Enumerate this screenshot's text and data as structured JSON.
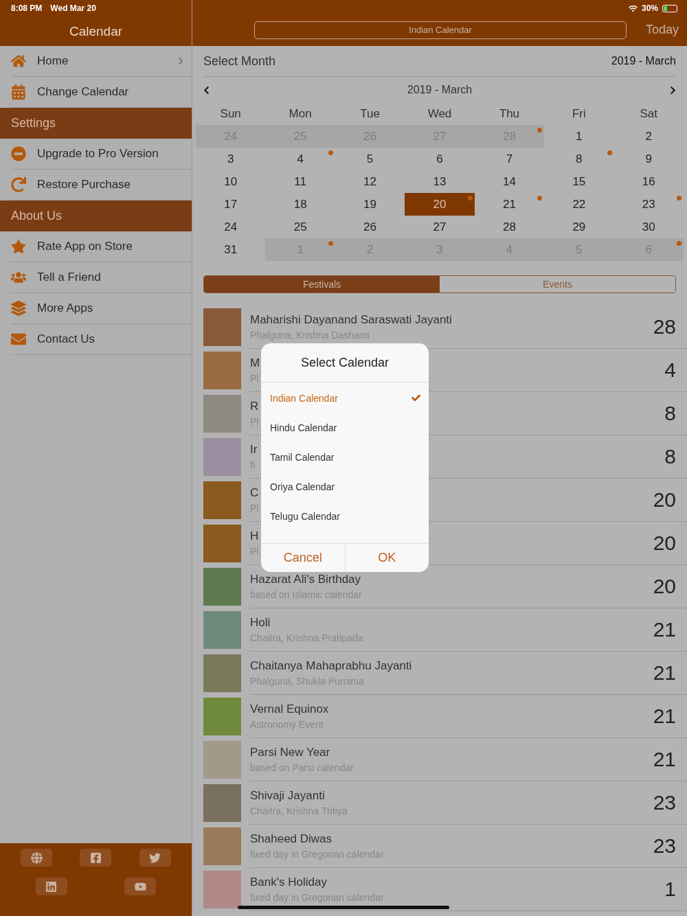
{
  "status_bar": {
    "time": "8:08 PM",
    "date": "Wed Mar 20",
    "battery": "30%"
  },
  "sidebar": {
    "title": "Calendar",
    "groups": [
      {
        "items": [
          {
            "label": "Home",
            "disclosure": true
          },
          {
            "label": "Change Calendar",
            "disclosure": false
          }
        ]
      },
      {
        "heading": "Settings",
        "items": [
          {
            "label": "Upgrade to Pro Version",
            "disclosure": false
          },
          {
            "label": "Restore Purchase",
            "disclosure": false
          }
        ]
      },
      {
        "heading": "About Us",
        "items": [
          {
            "label": "Rate App on Store",
            "disclosure": false
          },
          {
            "label": "Tell a Friend",
            "disclosure": false
          },
          {
            "label": "More Apps",
            "disclosure": false
          },
          {
            "label": "Contact Us",
            "disclosure": false
          }
        ]
      }
    ]
  },
  "nav_bar": {
    "calendar_button": "Indian Calendar",
    "today_button": "Today"
  },
  "month_selector": {
    "label": "Select Month",
    "value": "2019 - March"
  },
  "calendar": {
    "title": "2019 - March",
    "weekdays": [
      "Sun",
      "Mon",
      "Tue",
      "Wed",
      "Thu",
      "Fri",
      "Sat"
    ],
    "weeks": [
      [
        {
          "day": "24",
          "in_month": false,
          "event": false,
          "selected": false
        },
        {
          "day": "25",
          "in_month": false,
          "event": false,
          "selected": false
        },
        {
          "day": "26",
          "in_month": false,
          "event": false,
          "selected": false
        },
        {
          "day": "27",
          "in_month": false,
          "event": false,
          "selected": false
        },
        {
          "day": "28",
          "in_month": false,
          "event": true,
          "selected": false
        },
        {
          "day": "1",
          "in_month": true,
          "event": false,
          "selected": false
        },
        {
          "day": "2",
          "in_month": true,
          "event": false,
          "selected": false
        }
      ],
      [
        {
          "day": "3",
          "in_month": true,
          "event": false,
          "selected": false
        },
        {
          "day": "4",
          "in_month": true,
          "event": true,
          "selected": false
        },
        {
          "day": "5",
          "in_month": true,
          "event": false,
          "selected": false
        },
        {
          "day": "6",
          "in_month": true,
          "event": false,
          "selected": false
        },
        {
          "day": "7",
          "in_month": true,
          "event": false,
          "selected": false
        },
        {
          "day": "8",
          "in_month": true,
          "event": true,
          "selected": false
        },
        {
          "day": "9",
          "in_month": true,
          "event": false,
          "selected": false
        }
      ],
      [
        {
          "day": "10",
          "in_month": true,
          "event": false,
          "selected": false
        },
        {
          "day": "11",
          "in_month": true,
          "event": false,
          "selected": false
        },
        {
          "day": "12",
          "in_month": true,
          "event": false,
          "selected": false
        },
        {
          "day": "13",
          "in_month": true,
          "event": false,
          "selected": false
        },
        {
          "day": "14",
          "in_month": true,
          "event": false,
          "selected": false
        },
        {
          "day": "15",
          "in_month": true,
          "event": false,
          "selected": false
        },
        {
          "day": "16",
          "in_month": true,
          "event": false,
          "selected": false
        }
      ],
      [
        {
          "day": "17",
          "in_month": true,
          "event": false,
          "selected": false
        },
        {
          "day": "18",
          "in_month": true,
          "event": false,
          "selected": false
        },
        {
          "day": "19",
          "in_month": true,
          "event": false,
          "selected": false
        },
        {
          "day": "20",
          "in_month": true,
          "event": true,
          "selected": true
        },
        {
          "day": "21",
          "in_month": true,
          "event": true,
          "selected": false
        },
        {
          "day": "22",
          "in_month": true,
          "event": false,
          "selected": false
        },
        {
          "day": "23",
          "in_month": true,
          "event": true,
          "selected": false
        }
      ],
      [
        {
          "day": "24",
          "in_month": true,
          "event": false,
          "selected": false
        },
        {
          "day": "25",
          "in_month": true,
          "event": false,
          "selected": false
        },
        {
          "day": "26",
          "in_month": true,
          "event": false,
          "selected": false
        },
        {
          "day": "27",
          "in_month": true,
          "event": false,
          "selected": false
        },
        {
          "day": "28",
          "in_month": true,
          "event": false,
          "selected": false
        },
        {
          "day": "29",
          "in_month": true,
          "event": false,
          "selected": false
        },
        {
          "day": "30",
          "in_month": true,
          "event": false,
          "selected": false
        }
      ],
      [
        {
          "day": "31",
          "in_month": true,
          "event": false,
          "selected": false
        },
        {
          "day": "1",
          "in_month": false,
          "event": true,
          "selected": false
        },
        {
          "day": "2",
          "in_month": false,
          "event": false,
          "selected": false
        },
        {
          "day": "3",
          "in_month": false,
          "event": false,
          "selected": false
        },
        {
          "day": "4",
          "in_month": false,
          "event": false,
          "selected": false
        },
        {
          "day": "5",
          "in_month": false,
          "event": false,
          "selected": false
        },
        {
          "day": "6",
          "in_month": false,
          "event": true,
          "selected": false
        }
      ]
    ]
  },
  "segments": [
    {
      "label": "Festivals",
      "selected": true
    },
    {
      "label": "Events",
      "selected": false
    }
  ],
  "events": [
    {
      "title": "Maharishi Dayanand Saraswati Jayanti",
      "subtitle": "Phalguna, Krishna Dashami",
      "date": "28"
    },
    {
      "title": "M",
      "subtitle": "Pl",
      "date": "4"
    },
    {
      "title": "R",
      "subtitle": "Pl",
      "date": "8"
    },
    {
      "title": "Ir",
      "subtitle": "fi",
      "date": "8"
    },
    {
      "title": "C",
      "subtitle": "Pl",
      "date": "20"
    },
    {
      "title": "H",
      "subtitle": "Pl",
      "date": "20"
    },
    {
      "title": "Hazarat Ali's Birthday",
      "subtitle": "based on Islamic calendar",
      "date": "20"
    },
    {
      "title": "Holi",
      "subtitle": "Chaitra, Krishna Pratipada",
      "date": "21"
    },
    {
      "title": "Chaitanya Mahaprabhu Jayanti",
      "subtitle": "Phalguna, Shukla Purnima",
      "date": "21"
    },
    {
      "title": "Vernal Equinox",
      "subtitle": "Astronomy Event",
      "date": "21"
    },
    {
      "title": "Parsi New Year",
      "subtitle": "based on Parsi calendar",
      "date": "21"
    },
    {
      "title": "Shivaji Jayanti",
      "subtitle": "Chaitra, Krishna Tritiya",
      "date": "23"
    },
    {
      "title": "Shaheed Diwas",
      "subtitle": "fixed day in Gregorian calendar",
      "date": "23"
    },
    {
      "title": "Bank's Holiday",
      "subtitle": "fixed day in Gregorian calendar",
      "date": "1"
    }
  ],
  "dialog": {
    "title": "Select Calendar",
    "options": [
      {
        "label": "Indian Calendar",
        "selected": true
      },
      {
        "label": "Hindu Calendar",
        "selected": false
      },
      {
        "label": "Tamil Calendar",
        "selected": false
      },
      {
        "label": "Oriya Calendar",
        "selected": false
      },
      {
        "label": "Telugu Calendar",
        "selected": false
      }
    ],
    "buttons": [
      "Cancel",
      "OK"
    ]
  }
}
